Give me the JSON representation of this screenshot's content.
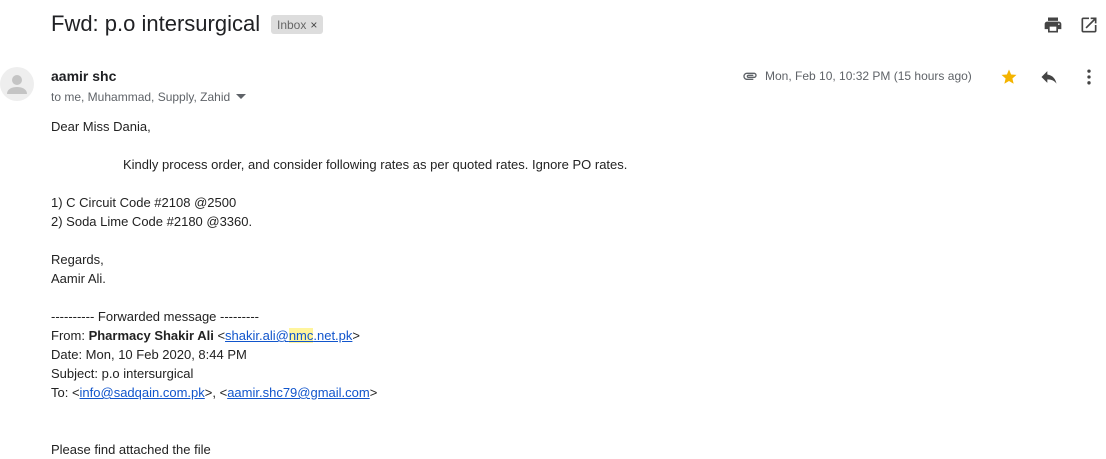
{
  "header": {
    "subject": "Fwd: p.o intersurgical",
    "label": "Inbox",
    "label_remove": "×"
  },
  "message": {
    "sender": "aamir shc",
    "recipients": "to me, Muhammad, Supply, Zahid",
    "date": "Mon, Feb 10, 10:32 PM (15 hours ago)",
    "starred": true,
    "star_color": "#f4b400",
    "body": {
      "greeting": "Dear Miss Dania,",
      "instruction": "Kindly process order, and consider following rates as per quoted rates. Ignore PO rates.",
      "item1": "1) C Circuit Code #2108 @2500",
      "item2": "2) Soda Lime Code #2180 @3360.",
      "regards": "Regards,",
      "signature": "Aamir Ali.",
      "forwarded_header": "---------- Forwarded message ---------",
      "from_label": "From: ",
      "from_name": "Pharmacy Shakir Ali",
      "from_email_prefix": "shakir.ali@",
      "from_email_highlight": "nmc",
      "from_email_suffix": ".net.pk",
      "lt": "<",
      "gt": ">",
      "date_line": "Date: Mon, 10 Feb 2020, 8:44 PM",
      "subject_line": "Subject: p.o intersurgical",
      "to_label": "To: <",
      "to_email1": "info@sadqain.com.pk",
      "to_sep": ">, <",
      "to_email2": "aamir.shc79@gmail.com",
      "to_end": ">",
      "trailing": "Please find attached the file"
    }
  },
  "icons": {
    "print": "print-icon",
    "open_new_window": "open-in-new-window-icon",
    "attachment": "paperclip-icon",
    "star": "star-icon",
    "reply": "reply-icon",
    "more": "more-vert-icon",
    "dropdown": "caret-down-icon",
    "avatar": "default-avatar-icon"
  }
}
